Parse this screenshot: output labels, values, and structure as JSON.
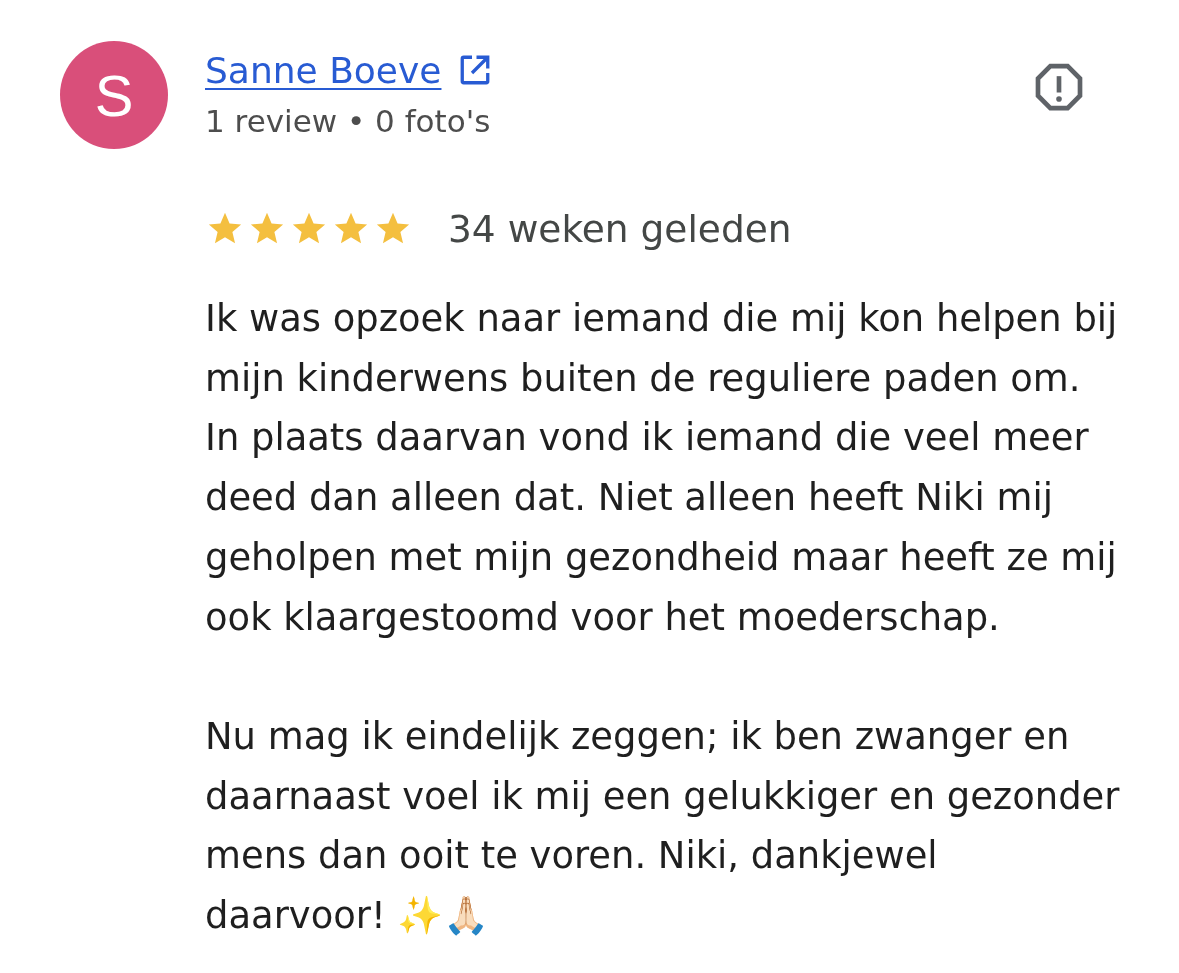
{
  "reviewer": {
    "initial": "S",
    "name": "Sanne Boeve",
    "stats": "1 review • 0 foto's"
  },
  "review": {
    "stars": 5,
    "time": "34 weken geleden",
    "paragraphs": [
      "Ik was opzoek naar iemand die mij kon helpen bij mijn kinderwens buiten de reguliere paden om. In plaats daarvan vond ik iemand die veel meer deed dan alleen dat. Niet alleen heeft Niki mij geholpen met mijn gezondheid maar heeft ze mij ook klaargestoomd voor het moederschap.",
      "Nu mag ik eindelijk zeggen; ik ben zwanger en daarnaast voel ik mij een gelukkiger en gezonder mens dan ooit te voren. Niki, dankjewel daarvoor! ✨🙏🏻"
    ]
  }
}
